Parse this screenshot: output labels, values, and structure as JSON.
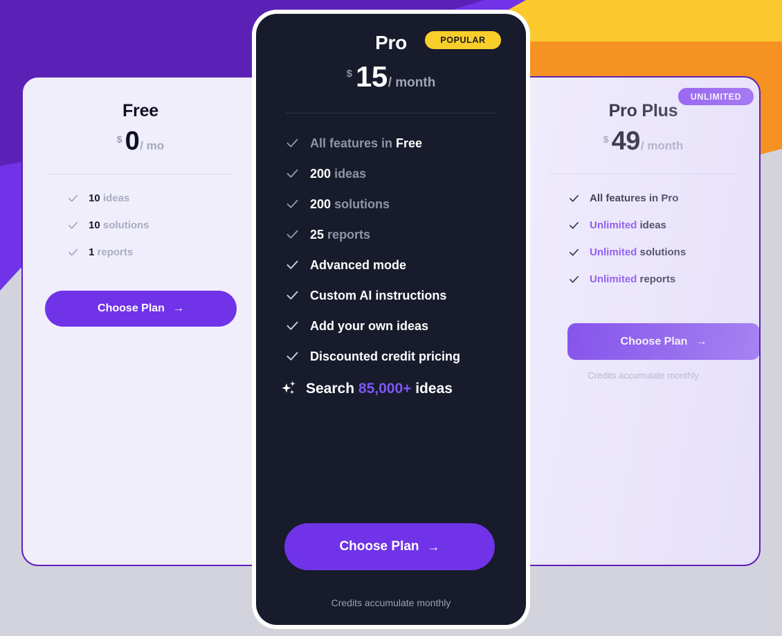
{
  "background": {
    "base_color": "#d3d3dd",
    "purple_dark": "#5b21b6",
    "purple_light": "#7033e8",
    "yellow": "#fbc92e",
    "orange": "#f59222"
  },
  "plans": [
    {
      "id": "free",
      "name": "Free",
      "currency": "$",
      "amount": "0",
      "period": "/ mo",
      "badge": null,
      "features": [
        {
          "value": "10",
          "label": "ideas"
        },
        {
          "value": "10",
          "label": "solutions"
        },
        {
          "value": "1",
          "label": "reports"
        }
      ],
      "cta_label": "Choose Plan",
      "cta_arrow": "→",
      "note": null
    },
    {
      "id": "pro",
      "name": "Pro",
      "currency": "$",
      "amount": "15",
      "period": "/ month",
      "badge": {
        "text": "POPULAR",
        "color": "#f8ce2b"
      },
      "features": [
        {
          "lead": "All features in ",
          "value": "Free",
          "label": "",
          "style": "lead-muted"
        },
        {
          "lead": "",
          "value": "200",
          "label": "ideas",
          "style": "value-white"
        },
        {
          "lead": "",
          "value": "200",
          "label": "solutions",
          "style": "value-white"
        },
        {
          "lead": "",
          "value": "25",
          "label": "reports",
          "style": "value-white"
        },
        {
          "lead": "",
          "value": "",
          "label": "Advanced mode",
          "style": "all-white"
        },
        {
          "lead": "",
          "value": "",
          "label": "Custom AI instructions",
          "style": "all-white"
        },
        {
          "lead": "",
          "value": "",
          "label": "Add your own ideas",
          "style": "all-white"
        },
        {
          "lead": "",
          "value": "",
          "label": "Discounted credit pricing",
          "style": "all-white"
        }
      ],
      "search_feature": {
        "icon": "sparkle-icon",
        "prefix": "Search ",
        "highlight": "85,000+",
        "suffix": " ideas"
      },
      "cta_label": "Choose Plan",
      "cta_arrow": "→",
      "note": "Credits accumulate monthly"
    },
    {
      "id": "pro-plus",
      "name": "Pro Plus",
      "currency": "$",
      "amount": "49",
      "period": "/ month",
      "badge": {
        "text": "UNLIMITED",
        "color": "#7c3aed"
      },
      "features": [
        {
          "highlight": "",
          "label": "All features in Pro"
        },
        {
          "highlight": "Unlimited",
          "label": "ideas"
        },
        {
          "highlight": "Unlimited",
          "label": "solutions"
        },
        {
          "highlight": "Unlimited",
          "label": "reports"
        }
      ],
      "cta_label": "Choose Plan",
      "cta_arrow": "→",
      "note": "Credits accumulate monthly"
    }
  ]
}
